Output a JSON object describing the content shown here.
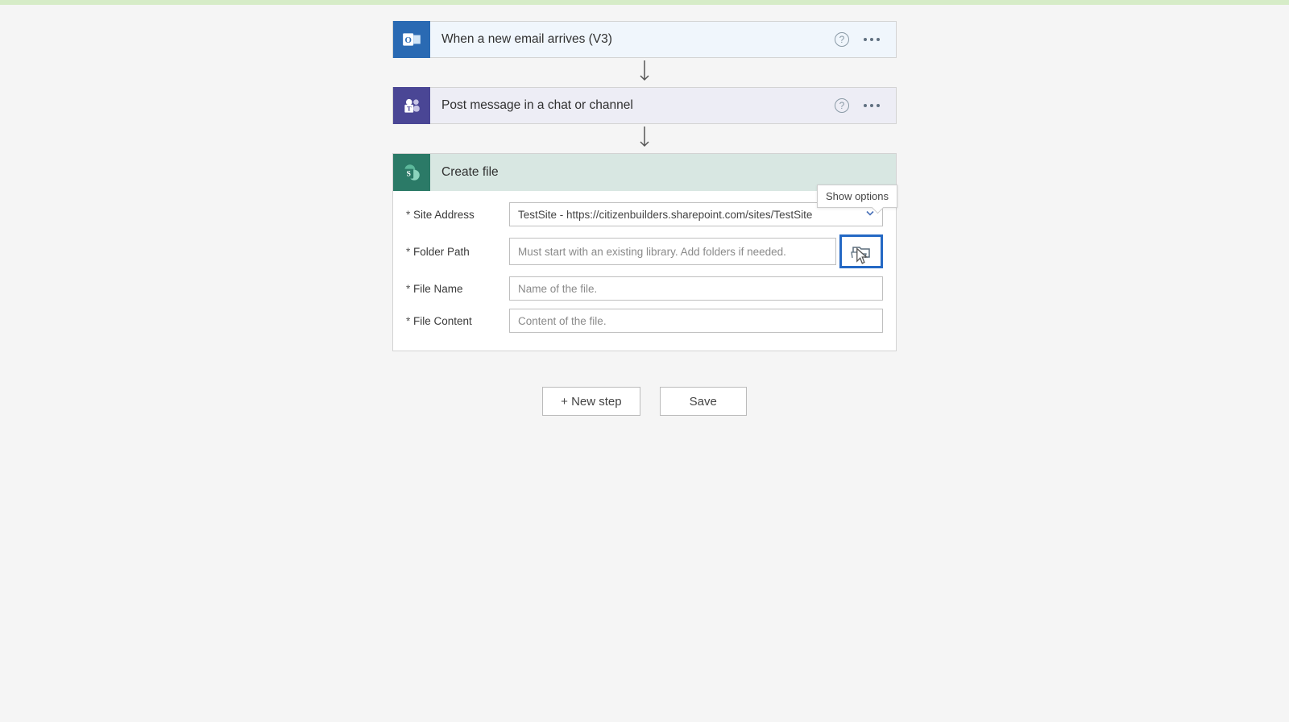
{
  "trigger": {
    "title": "When a new email arrives (V3)"
  },
  "action_teams": {
    "title": "Post message in a chat or channel"
  },
  "action_sp": {
    "title": "Create file",
    "show_options": "Show options",
    "fields": {
      "site_address": {
        "label": "Site Address",
        "value": "TestSite - https://citizenbuilders.sharepoint.com/sites/TestSite"
      },
      "folder_path": {
        "label": "Folder Path",
        "placeholder": "Must start with an existing library. Add folders if needed."
      },
      "file_name": {
        "label": "File Name",
        "placeholder": "Name of the file."
      },
      "file_content": {
        "label": "File Content",
        "placeholder": "Content of the file."
      }
    }
  },
  "buttons": {
    "new_step": "+ New step",
    "save": "Save"
  }
}
